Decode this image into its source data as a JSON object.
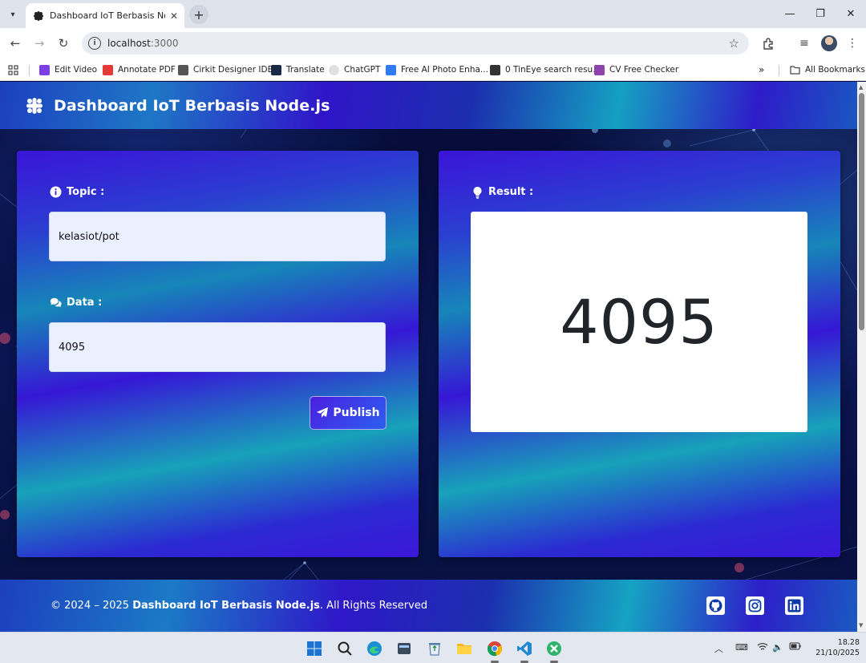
{
  "browser": {
    "tab_title": "Dashboard IoT Berbasis Node.js",
    "url_host": "localhost",
    "url_port": ":3000",
    "bookmarks": [
      {
        "label": "Edit Video",
        "icon": "edit-video-icon",
        "color": "#7b3fe4"
      },
      {
        "label": "Annotate PDF",
        "icon": "pdf24-icon",
        "color": "#e53935"
      },
      {
        "label": "Cirkit Designer IDE",
        "icon": "cirkit-icon",
        "color": "#555555"
      },
      {
        "label": "Translate",
        "icon": "translate-icon",
        "color": "#1a2a44"
      },
      {
        "label": "ChatGPT",
        "icon": "chatgpt-icon",
        "color": "#cfcfcf"
      },
      {
        "label": "Free AI Photo Enha...",
        "icon": "photo-enhancer-icon",
        "color": "#2f7bf6"
      },
      {
        "label": "0 TinEye search resu...",
        "icon": "tineye-icon",
        "color": "#333333"
      },
      {
        "label": "CV Free Checker",
        "icon": "cv-checker-icon",
        "color": "#8e44ad"
      }
    ],
    "more_bookmarks": "»",
    "all_bookmarks": "All Bookmarks"
  },
  "header": {
    "brand": "Dashboard IoT Berbasis Node.js"
  },
  "publisher": {
    "topic_label": "Topic :",
    "topic_value": "kelasiot/pot",
    "data_label": "Data :",
    "data_value": "4095",
    "publish_label": "Publish"
  },
  "result": {
    "label": "Result :",
    "value": "4095"
  },
  "footer": {
    "copy_prefix": "© 2024 – 2025 ",
    "copy_brand": "Dashboard IoT Berbasis Node.js",
    "copy_suffix": ". All Rights Reserved",
    "social": [
      "github-icon",
      "instagram-icon",
      "linkedin-icon"
    ]
  },
  "taskbar": {
    "time": "18.28",
    "date": "21/10/2025",
    "apps": [
      "windows-start-icon",
      "search-icon",
      "edge-icon",
      "file-manager-icon",
      "recycle-icon",
      "folder-icon",
      "chrome-icon",
      "vscode-icon",
      "xampp-icon"
    ]
  },
  "colors": {
    "header_gradient": [
      "#1d3fbf",
      "#3015c8",
      "#15a0c2"
    ],
    "card_gradient": [
      "#3a14d8",
      "#1686b8",
      "#17a2b9"
    ],
    "field_bg": "#eaf0ff",
    "result_bg": "#ffffff"
  }
}
